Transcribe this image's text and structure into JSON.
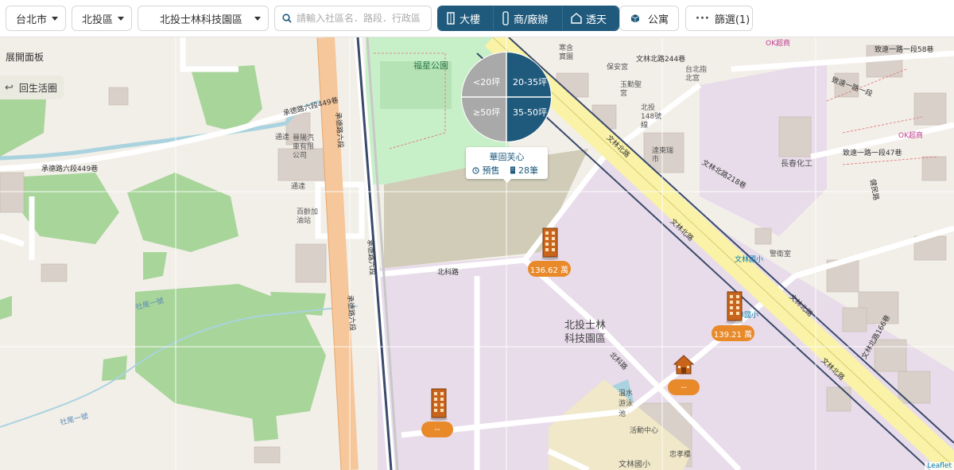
{
  "toolbar": {
    "city": "台北市",
    "district": "北投區",
    "community": "北投士林科技園區",
    "search_placeholder": "請輸入社區名．路段．行政區",
    "types": [
      {
        "label": "大樓",
        "icon": "building-icon"
      },
      {
        "label": "商/廠辦",
        "icon": "office-icon"
      },
      {
        "label": "透天",
        "icon": "house-icon"
      }
    ],
    "apartment_label": "公寓",
    "filter_label": "篩選(1)"
  },
  "side": {
    "expand_panel": "展開面板",
    "back_to_area": "回生活圈"
  },
  "pie": {
    "segments": [
      "<20坪",
      "20-35坪",
      "≥50坪",
      "35-50坪"
    ],
    "active_color": "#1f5a7d",
    "inactive_color": "#a9a9a9"
  },
  "info_card": {
    "name": "華固芙心",
    "status": "預售",
    "count": "28筆"
  },
  "markers": [
    {
      "type": "building",
      "price": "136.62 萬"
    },
    {
      "type": "building",
      "price": "139.21 萬"
    },
    {
      "type": "house",
      "price": "--"
    },
    {
      "type": "building",
      "price": "--"
    }
  ],
  "map_labels": {
    "park": "福星公園",
    "zone": [
      "北投士林",
      "科技園區"
    ],
    "beike_road": "北科路",
    "beike_road2": "北科路",
    "chengde_6": "承德路六段",
    "chengde_6b": "承德路六段",
    "chengde_6c": "承德路六段",
    "chengde_449": "承德路六段449巷",
    "chengde_449b": "承德路六段449巷",
    "wenlin_n": "文林北路",
    "wenlin_n2": "文林北路",
    "wenlin_n3": "文林北路",
    "wenlin_n4": "文林北路",
    "wenlin_218": "文林北路218巷",
    "wenlin_244": "文林北路244巷",
    "wenlin_166": "文林北路166巷",
    "zhixin": "致遠一路一段58巷",
    "zhixin2": "致遠一路一段47巷",
    "changchun": "長春化工",
    "wenlin_school": "文林國小",
    "wenlin_school2": "林國小",
    "wenlin_school3": "文林國小",
    "swim": "溫水游泳池",
    "activity": "活動中心",
    "zhongxiao": "忠孝樓",
    "jingcha": "警衛室",
    "jianmin": "健民路",
    "okmart": "OK超商",
    "okmart2": "OK超商",
    "baoan": "保安宮",
    "jinkuo": "晉陽汽車有限公司",
    "tongxiang": "通達",
    "tongxiang2": "通達",
    "gas": "百齡加油站",
    "dalong": "達東瑞市",
    "taiyang": "台北指北宮",
    "yuxing": "玉勤聖宮",
    "beitou148": "北投148號線",
    "binjiang": "寒含寶園",
    "houshan": "社尾一號",
    "houshan2": "社尾一號",
    "lane1": "致遠一路一段",
    "attribution": "Leaflet"
  }
}
